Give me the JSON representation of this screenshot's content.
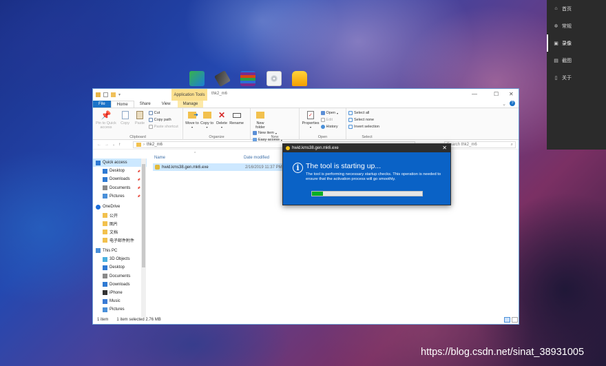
{
  "desktop": {
    "icons": [
      "network-tool-icon",
      "usb-tool-icon",
      "winrar-archive-icon",
      "disc-image-icon",
      "kms-tool-icon"
    ]
  },
  "control_panel": {
    "items": [
      {
        "label": "首页",
        "icon": "home-icon",
        "active": false
      },
      {
        "label": "常规",
        "icon": "gear-icon",
        "active": false
      },
      {
        "label": "录像",
        "icon": "record-icon",
        "active": true
      },
      {
        "label": "截图",
        "icon": "screenshot-icon",
        "active": false
      },
      {
        "label": "关于",
        "icon": "info-icon",
        "active": false
      }
    ]
  },
  "explorer": {
    "context_tab": "Application Tools",
    "title": "thk2_m6",
    "tabs": [
      "File",
      "Home",
      "Share",
      "View",
      "Manage"
    ],
    "ribbon": {
      "clipboard": {
        "label": "Clipboard",
        "pin": "Pin to Quick access",
        "copy": "Copy",
        "paste": "Paste",
        "cut": "Cut",
        "copy_path": "Copy path",
        "paste_shortcut": "Paste shortcut"
      },
      "organize": {
        "label": "Organize",
        "move_to": "Move to",
        "copy_to": "Copy to",
        "delete": "Delete",
        "rename": "Rename"
      },
      "new": {
        "label": "New",
        "new_folder": "New folder",
        "new_item": "New item",
        "easy_access": "Easy access"
      },
      "open": {
        "label": "Open",
        "properties": "Properties",
        "open": "Open",
        "edit": "Edit",
        "history": "History"
      },
      "select": {
        "label": "Select",
        "select_all": "Select all",
        "select_none": "Select none",
        "invert": "Invert selection"
      }
    },
    "address": "thk2_m6",
    "search_placeholder": "Search thk2_m6",
    "nav": [
      {
        "label": "Quick access",
        "icon": "star-icon",
        "level": 0,
        "selected": true,
        "pinned": false
      },
      {
        "label": "Desktop",
        "icon": "desktop-icon",
        "level": 1,
        "pinned": true
      },
      {
        "label": "Downloads",
        "icon": "download-icon",
        "level": 1,
        "pinned": true
      },
      {
        "label": "Documents",
        "icon": "documents-icon",
        "level": 1,
        "pinned": true
      },
      {
        "label": "Pictures",
        "icon": "pictures-icon",
        "level": 1,
        "pinned": true
      },
      {
        "label": "OneDrive",
        "icon": "cloud-icon",
        "level": 0,
        "spacer": true
      },
      {
        "label": "公开",
        "icon": "folder-icon",
        "level": 1
      },
      {
        "label": "图片",
        "icon": "folder-icon",
        "level": 1
      },
      {
        "label": "文档",
        "icon": "folder-icon",
        "level": 1
      },
      {
        "label": "电子邮件附件",
        "icon": "folder-icon",
        "level": 1
      },
      {
        "label": "This PC",
        "icon": "pc-icon",
        "level": 0,
        "spacer": true
      },
      {
        "label": "3D Objects",
        "icon": "cube-icon",
        "level": 1
      },
      {
        "label": "Desktop",
        "icon": "desktop-icon",
        "level": 1
      },
      {
        "label": "Documents",
        "icon": "documents-icon",
        "level": 1
      },
      {
        "label": "Downloads",
        "icon": "download-icon",
        "level": 1
      },
      {
        "label": "iPhone",
        "icon": "phone-icon",
        "level": 1
      },
      {
        "label": "Music",
        "icon": "music-icon",
        "level": 1
      },
      {
        "label": "Pictures",
        "icon": "pictures-icon",
        "level": 1
      }
    ],
    "columns": [
      "Name",
      "Date modified"
    ],
    "files": [
      {
        "name": "hwid.kms38.gen.mk6.exe",
        "date": "2/16/2019 11:37 PM",
        "selected": true
      }
    ],
    "status_items": "1 item",
    "status_selected": "1 item selected  2.76 MB"
  },
  "dialog": {
    "title": "hwid.kms38.gen.mk6.exe",
    "heading": "The tool is starting up...",
    "message": "The tool is performing necessary startup checks. This operation is needed to ensure that the activation process will go smoothly.",
    "progress": 0.1
  },
  "watermark": "https://blog.csdn.net/sinat_38931005"
}
